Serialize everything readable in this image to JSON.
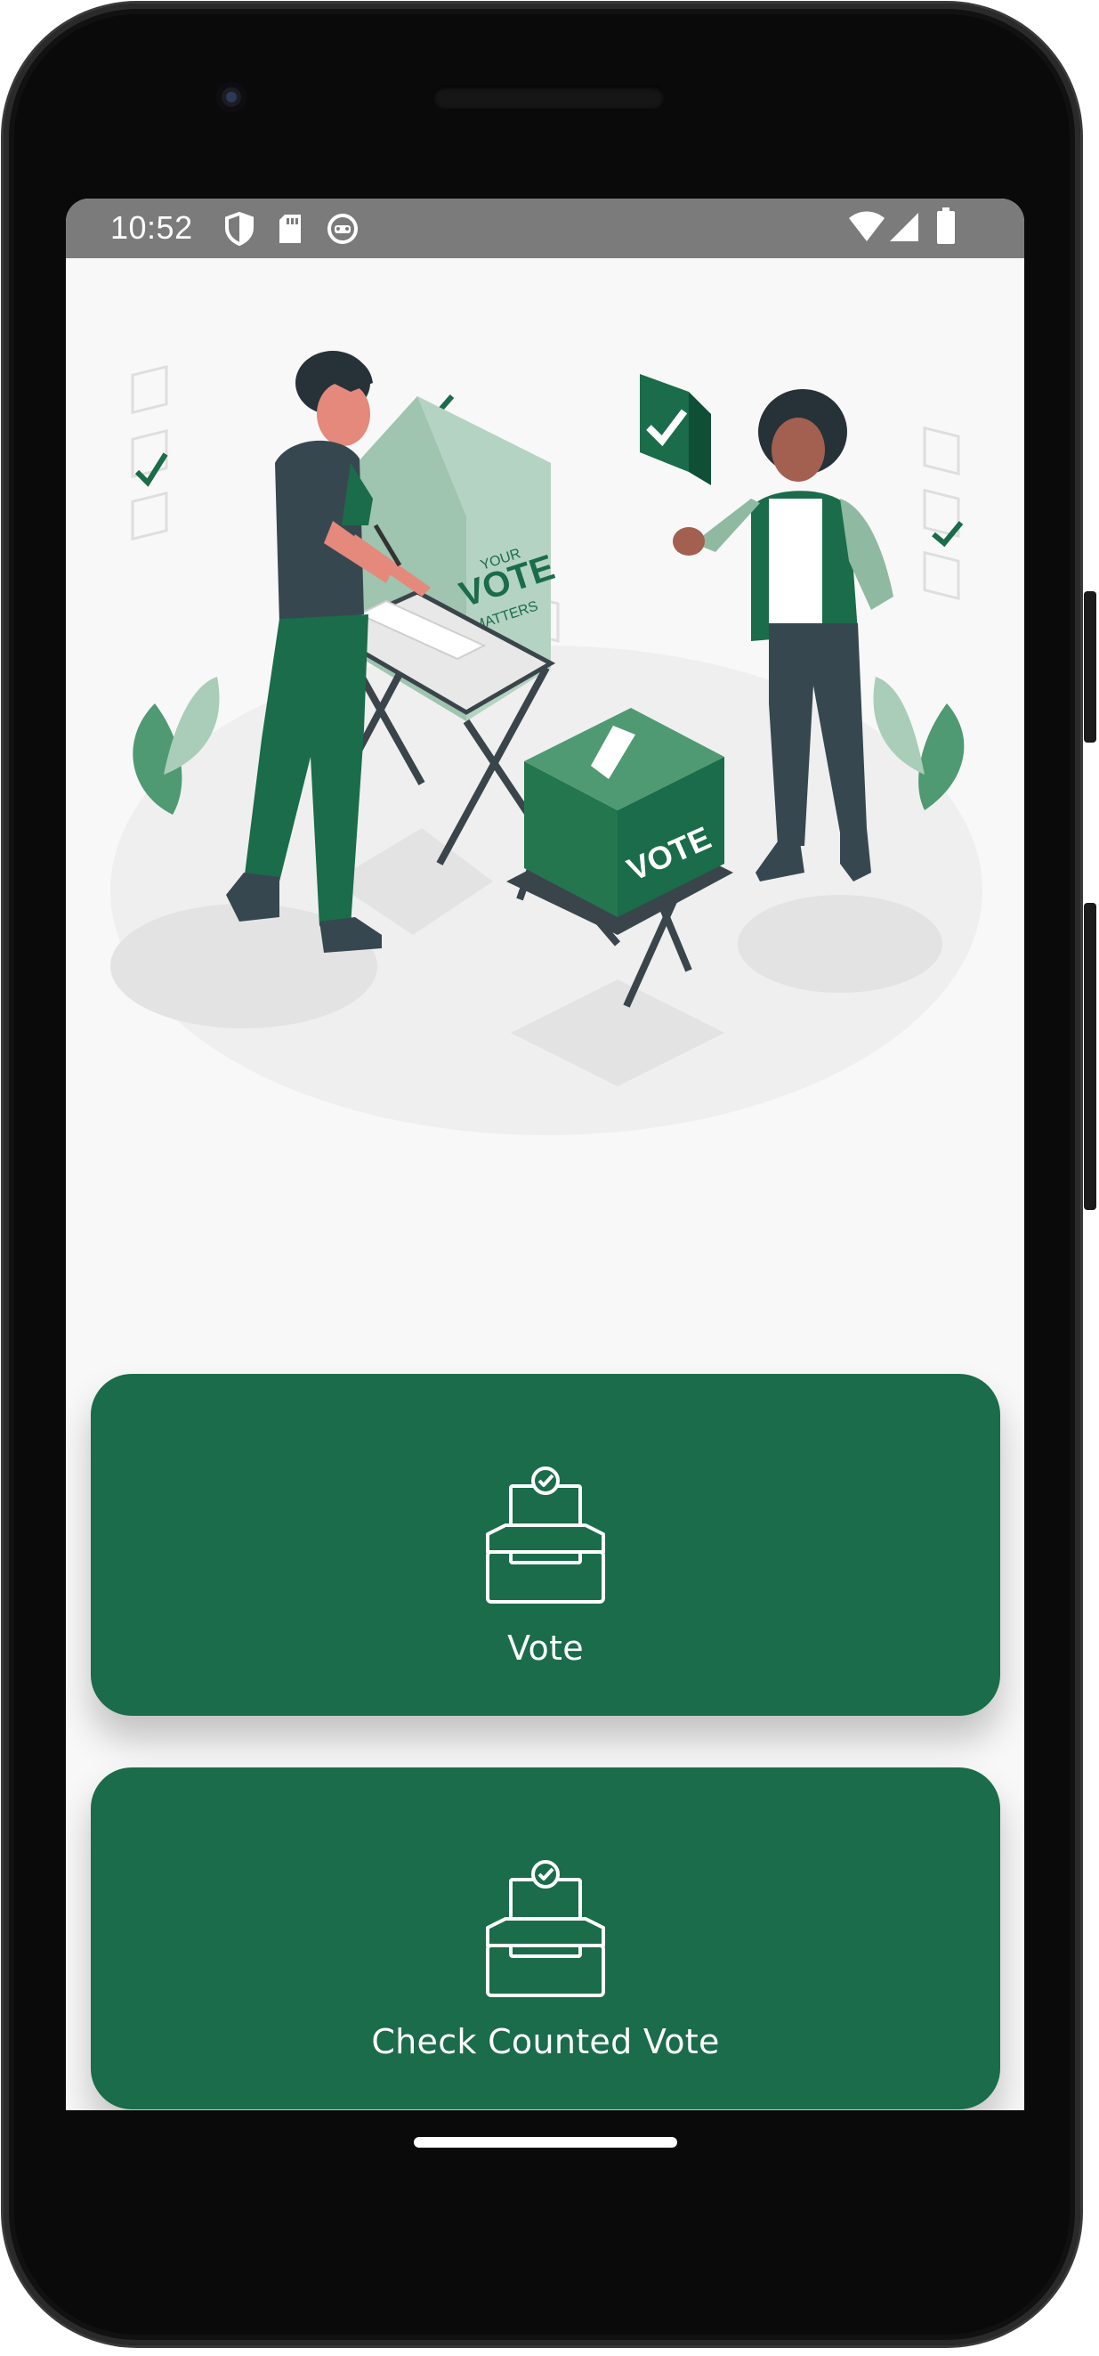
{
  "status_bar": {
    "time": "10:52",
    "left_icons": [
      "shield-icon",
      "sd-card-icon",
      "robot-face-icon"
    ],
    "right_icons": [
      "wifi-icon",
      "cell-signal-icon",
      "battery-icon"
    ]
  },
  "illustration": {
    "booth_text_top": "YOUR",
    "booth_text_main": "VOTE",
    "booth_text_bottom": "MATTERS",
    "box_text": "VOTE"
  },
  "actions": [
    {
      "label": "Vote",
      "icon": "ballot-box-icon"
    },
    {
      "label": "Check Counted Vote",
      "icon": "ballot-box-icon"
    }
  ],
  "colors": {
    "primary": "#1a6c4a",
    "status_bar": "#7b7b7b",
    "background": "#f8f8f8"
  }
}
